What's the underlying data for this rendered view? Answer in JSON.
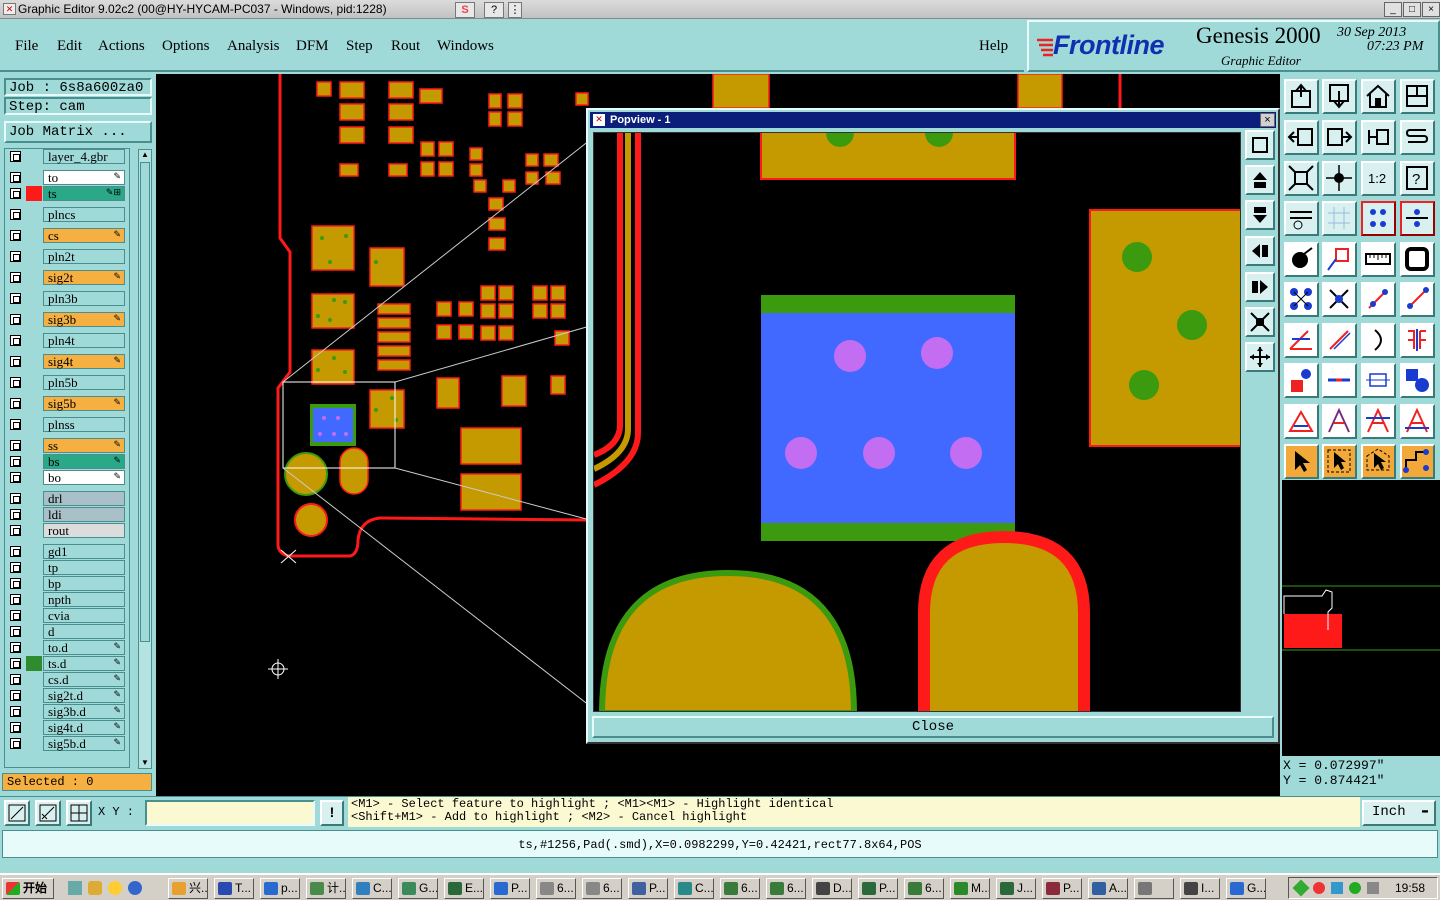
{
  "window": {
    "title": "Graphic Editor 9.02c2 (00@HY-HYCAM-PC037 - Windows, pid:1228)",
    "toolbar_icons": [
      "sogou-icon",
      "help-icon",
      "dropdown-icon"
    ],
    "controls": {
      "minimize": "_",
      "maximize": "□",
      "close": "×"
    }
  },
  "menu": {
    "items": [
      "File",
      "Edit",
      "Actions",
      "Options",
      "Analysis",
      "DFM",
      "Step",
      "Rout",
      "Windows"
    ],
    "help": "Help"
  },
  "brand": {
    "logo": "Frontline",
    "product": "Genesis 2000",
    "subtitle": "Graphic Editor",
    "date": "30 Sep 2013",
    "time": "07:23 PM"
  },
  "job": {
    "job_line": "Job : 6s8a600za0",
    "step_line": "Step: cam",
    "matrix_button": "Job Matrix ..."
  },
  "layers": [
    {
      "name": "layer_4.gbr",
      "color": "#9fd9d8",
      "swatch": "",
      "marker": ""
    },
    {
      "name": "to",
      "color": "#ffffff",
      "swatch": "",
      "marker": "✎"
    },
    {
      "name": "ts",
      "color": "#2aa887",
      "swatch": "#ff1a1a",
      "marker": "✎⊞"
    },
    {
      "name": "plncs",
      "color": "#9fd9d8",
      "swatch": "",
      "marker": ""
    },
    {
      "name": "cs",
      "color": "#f5b041",
      "swatch": "",
      "marker": "✎"
    },
    {
      "name": "pln2t",
      "color": "#9fd9d8",
      "swatch": "",
      "marker": ""
    },
    {
      "name": "sig2t",
      "color": "#f5b041",
      "swatch": "",
      "marker": "✎"
    },
    {
      "name": "pln3b",
      "color": "#9fd9d8",
      "swatch": "",
      "marker": ""
    },
    {
      "name": "sig3b",
      "color": "#f5b041",
      "swatch": "",
      "marker": "✎"
    },
    {
      "name": "pln4t",
      "color": "#9fd9d8",
      "swatch": "",
      "marker": ""
    },
    {
      "name": "sig4t",
      "color": "#f5b041",
      "swatch": "",
      "marker": "✎"
    },
    {
      "name": "pln5b",
      "color": "#9fd9d8",
      "swatch": "",
      "marker": ""
    },
    {
      "name": "sig5b",
      "color": "#f5b041",
      "swatch": "",
      "marker": "✎"
    },
    {
      "name": "plnss",
      "color": "#9fd9d8",
      "swatch": "",
      "marker": ""
    },
    {
      "name": "ss",
      "color": "#f5b041",
      "swatch": "",
      "marker": "✎"
    },
    {
      "name": "bs",
      "color": "#2aa887",
      "swatch": "",
      "marker": "✎"
    },
    {
      "name": "bo",
      "color": "#ffffff",
      "swatch": "",
      "marker": "✎"
    },
    {
      "name": "drl",
      "color": "#a9c0c9",
      "swatch": "",
      "marker": ""
    },
    {
      "name": "ldi",
      "color": "#a9c0c9",
      "swatch": "",
      "marker": ""
    },
    {
      "name": "rout",
      "color": "#dcdcdc",
      "swatch": "",
      "marker": ""
    },
    {
      "name": "gd1",
      "color": "#9fd9d8",
      "swatch": "",
      "marker": ""
    },
    {
      "name": "tp",
      "color": "#9fd9d8",
      "swatch": "",
      "marker": ""
    },
    {
      "name": "bp",
      "color": "#9fd9d8",
      "swatch": "",
      "marker": ""
    },
    {
      "name": "npth",
      "color": "#9fd9d8",
      "swatch": "",
      "marker": ""
    },
    {
      "name": "cvia",
      "color": "#9fd9d8",
      "swatch": "",
      "marker": ""
    },
    {
      "name": "d",
      "color": "#9fd9d8",
      "swatch": "",
      "marker": ""
    },
    {
      "name": "to.d",
      "color": "#9fd9d8",
      "swatch": "",
      "marker": "✎"
    },
    {
      "name": "ts.d",
      "color": "#9fd9d8",
      "swatch": "#2e8b2e",
      "marker": "✎"
    },
    {
      "name": "cs.d",
      "color": "#9fd9d8",
      "swatch": "",
      "marker": "✎"
    },
    {
      "name": "sig2t.d",
      "color": "#9fd9d8",
      "swatch": "",
      "marker": "✎"
    },
    {
      "name": "sig3b.d",
      "color": "#9fd9d8",
      "swatch": "",
      "marker": "✎"
    },
    {
      "name": "sig4t.d",
      "color": "#9fd9d8",
      "swatch": "",
      "marker": "✎"
    },
    {
      "name": "sig5b.d",
      "color": "#9fd9d8",
      "swatch": "",
      "marker": "✎"
    }
  ],
  "selected": "Selected : 0",
  "popview": {
    "title": "Popview - 1",
    "close_label": "Close"
  },
  "coords": {
    "x": "X = 0.072997\"",
    "y": "Y = 0.874421\""
  },
  "command": {
    "xy_label": "X Y :",
    "xy_value": "",
    "message_line1": "<M1> - Select feature to highlight ; <M1><M1> - Highlight identical",
    "message_line2": "<Shift+M1> - Add to highlight ; <M2> - Cancel highlight",
    "units": "Inch"
  },
  "status_line": "ts,#1256,Pad(.smd),X=0.0982299,Y=0.42421,rect77.8x64,POS",
  "taskbar": {
    "start": "开始",
    "tasks": [
      "兴..",
      "T...",
      "p...",
      "计..",
      "C...",
      "G...",
      "E...",
      "P...",
      "6...",
      "6...",
      "P...",
      "C...",
      "6...",
      "6...",
      "D...",
      "P...",
      "6...",
      "M...",
      "J...",
      "P...",
      "A...",
      "",
      "I...",
      "G..."
    ],
    "clock": "19:58"
  },
  "colors": {
    "panel": "#9fd9d8",
    "copper": "#c49a00",
    "mask_red": "#ff1a1a",
    "green": "#3c9a0f",
    "blue_pad": "#4169ff",
    "via": "#c36ef2"
  }
}
